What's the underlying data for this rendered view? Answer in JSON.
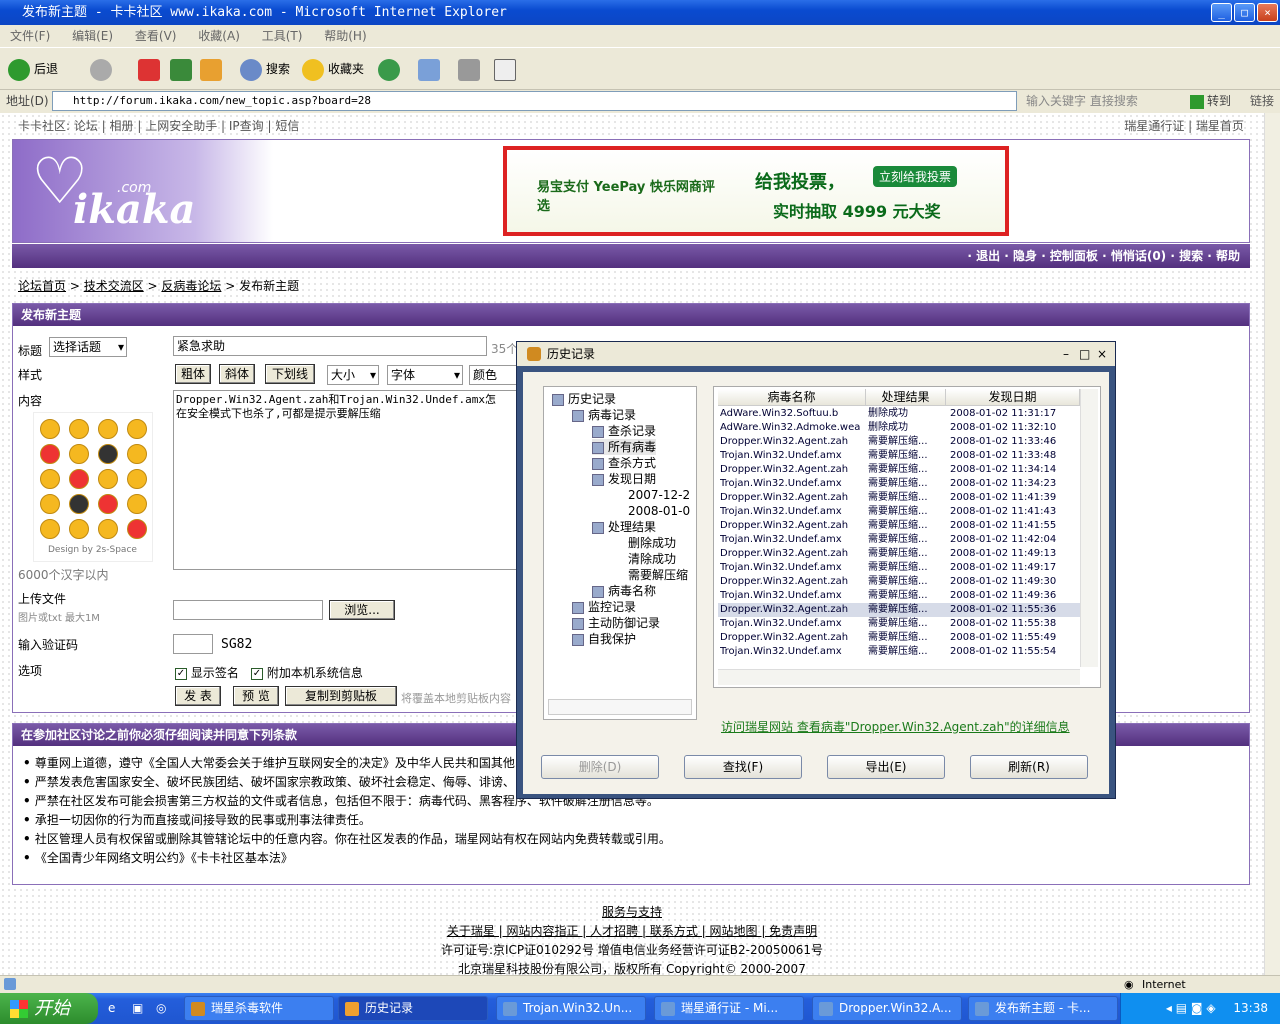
{
  "window": {
    "title": "发布新主题 - 卡卡社区 www.ikaka.com - Microsoft Internet Explorer"
  },
  "menu": [
    "文件(F)",
    "编辑(E)",
    "查看(V)",
    "收藏(A)",
    "工具(T)",
    "帮助(H)"
  ],
  "toolbar": {
    "back": "后退",
    "search": "搜索",
    "favorites": "收藏夹"
  },
  "address": {
    "label": "地址(D)",
    "url": "http://forum.ikaka.com/new_topic.asp?board=28",
    "hint": "输入关键字 直接搜索",
    "go": "转到",
    "links": "链接"
  },
  "site": {
    "topnav": "卡卡社区: 论坛 | 相册 | 上网安全助手 | IP查询 | 短信",
    "topnav_right": "瑞星通行证 | 瑞星首页",
    "logo": "ikaka",
    "logo_sub": ".com",
    "banner_line1": "给我投票，",
    "banner_line2": "实时抽取 4999 元大奖",
    "banner_brand": "易宝支付 YeePay 快乐网商评选",
    "banner_vote": "立刻给我投票",
    "nav": "· 退出  · 隐身  · 控制面板  · 悄悄话(0)  · 搜索  · 帮助"
  },
  "breadcrumb": [
    "论坛首页",
    "技术交流区",
    "反病毒论坛",
    "发布新主题"
  ],
  "form": {
    "panel_title": "发布新主题",
    "title_label": "标题",
    "topic_select": "选择话题",
    "title_value": "紧急求助",
    "title_limit": "35个",
    "style_label": "样式",
    "bold": "粗体",
    "italic": "斜体",
    "underline": "下划线",
    "size": "大小",
    "font": "字体",
    "color": "颜色",
    "content_label": "内容",
    "content_line1": "Dropper.Win32.Agent.zah和Trojan.Win32.Undef.amx怎",
    "content_line2": "在安全模式下也杀了,可都是提示要解压缩",
    "design": "Design by 2s-Space",
    "char_limit": "6000个汉字以内",
    "upload_label": "上传文件",
    "upload_hint": "图片或txt 最大1M",
    "browse": "浏览...",
    "captcha_label": "输入验证码",
    "captcha": "SG82",
    "options_label": "选项",
    "show_sign": "显示签名",
    "attach_info": "附加本机系统信息",
    "submit": "发 表",
    "preview": "预 览",
    "copy": "复制到剪贴板",
    "copy_hint": "将覆盖本地剪贴板内容"
  },
  "terms": {
    "title": "在参加社区讨论之前你必须仔细阅读并同意下列条款",
    "items": [
      "尊重网上道德，遵守《全国人大常委会关于维护互联网安全的决定》及中华人民共和国其他",
      "严禁发表危害国家安全、破坏民族团结、破坏国家宗教政策、破坏社会稳定、侮辱、诽谤、",
      "严禁在社区发布可能会损害第三方权益的文件或者信息，包括但不限于：病毒代码、黑客程序、软件破解注册信息等。",
      "承担一切因你的行为而直接或间接导致的民事或刑事法律责任。",
      "社区管理人员有权保留或删除其管辖论坛中的任意内容。你在社区发表的作品，瑞星网站有权在网站内免费转载或引用。",
      "《全国青少年网络文明公约》《卡卡社区基本法》"
    ]
  },
  "footer": {
    "line1": "服务与支持",
    "line2": "关于瑞星 | 网站内容指正 | 人才招聘 | 联系方式 | 网站地图 | 免责声明",
    "line3": "许可证号:京ICP证010292号 增值电信业务经营许可证B2-20050061号",
    "line4": "北京瑞星科技股份有限公司，版权所有 Copyright© 2000-2007"
  },
  "dialog": {
    "title": "历史记录",
    "tree": [
      {
        "label": "历史记录",
        "level": 0
      },
      {
        "label": "病毒记录",
        "level": 1
      },
      {
        "label": "查杀记录",
        "level": 2
      },
      {
        "label": "所有病毒",
        "level": 2
      },
      {
        "label": "查杀方式",
        "level": 2
      },
      {
        "label": "发现日期",
        "level": 2
      },
      {
        "label": "2007-12-2",
        "level": 3
      },
      {
        "label": "2008-01-0",
        "level": 3
      },
      {
        "label": "处理结果",
        "level": 2
      },
      {
        "label": "删除成功",
        "level": 3
      },
      {
        "label": "清除成功",
        "level": 3
      },
      {
        "label": "需要解压缩",
        "level": 3
      },
      {
        "label": "病毒名称",
        "level": 2
      },
      {
        "label": "监控记录",
        "level": 1
      },
      {
        "label": "主动防御记录",
        "level": 1
      },
      {
        "label": "自我保护",
        "level": 1
      }
    ],
    "columns": [
      "病毒名称",
      "处理结果",
      "发现日期"
    ],
    "rows": [
      [
        "AdWare.Win32.Softuu.b",
        "删除成功",
        "2008-01-02 11:31:17"
      ],
      [
        "AdWare.Win32.Admoke.wea",
        "删除成功",
        "2008-01-02 11:32:10"
      ],
      [
        "Dropper.Win32.Agent.zah",
        "需要解压缩...",
        "2008-01-02 11:33:46"
      ],
      [
        "Trojan.Win32.Undef.amx",
        "需要解压缩...",
        "2008-01-02 11:33:48"
      ],
      [
        "Dropper.Win32.Agent.zah",
        "需要解压缩...",
        "2008-01-02 11:34:14"
      ],
      [
        "Trojan.Win32.Undef.amx",
        "需要解压缩...",
        "2008-01-02 11:34:23"
      ],
      [
        "Dropper.Win32.Agent.zah",
        "需要解压缩...",
        "2008-01-02 11:41:39"
      ],
      [
        "Trojan.Win32.Undef.amx",
        "需要解压缩...",
        "2008-01-02 11:41:43"
      ],
      [
        "Dropper.Win32.Agent.zah",
        "需要解压缩...",
        "2008-01-02 11:41:55"
      ],
      [
        "Trojan.Win32.Undef.amx",
        "需要解压缩...",
        "2008-01-02 11:42:04"
      ],
      [
        "Dropper.Win32.Agent.zah",
        "需要解压缩...",
        "2008-01-02 11:49:13"
      ],
      [
        "Trojan.Win32.Undef.amx",
        "需要解压缩...",
        "2008-01-02 11:49:17"
      ],
      [
        "Dropper.Win32.Agent.zah",
        "需要解压缩...",
        "2008-01-02 11:49:30"
      ],
      [
        "Trojan.Win32.Undef.amx",
        "需要解压缩...",
        "2008-01-02 11:49:36"
      ],
      [
        "Dropper.Win32.Agent.zah",
        "需要解压缩...",
        "2008-01-02 11:55:36"
      ],
      [
        "Trojan.Win32.Undef.amx",
        "需要解压缩...",
        "2008-01-02 11:55:38"
      ],
      [
        "Dropper.Win32.Agent.zah",
        "需要解压缩...",
        "2008-01-02 11:55:49"
      ],
      [
        "Trojan.Win32.Undef.amx",
        "需要解压缩...",
        "2008-01-02 11:55:54"
      ]
    ],
    "selected_row": 14,
    "link": "访问瑞星网站 查看病毒\"Dropper.Win32.Agent.zah\"的详细信息",
    "buttons": [
      "删除(D)",
      "查找(F)",
      "导出(E)",
      "刷新(R)"
    ]
  },
  "status": {
    "zone": "Internet"
  },
  "taskbar": {
    "start": "开始",
    "tasks": [
      "瑞星杀毒软件",
      "历史记录",
      "Trojan.Win32.Un...",
      "瑞星通行证 - Mi...",
      "Dropper.Win32.A...",
      "发布新主题 - 卡..."
    ],
    "active_task": 1,
    "clock": "13:38"
  }
}
